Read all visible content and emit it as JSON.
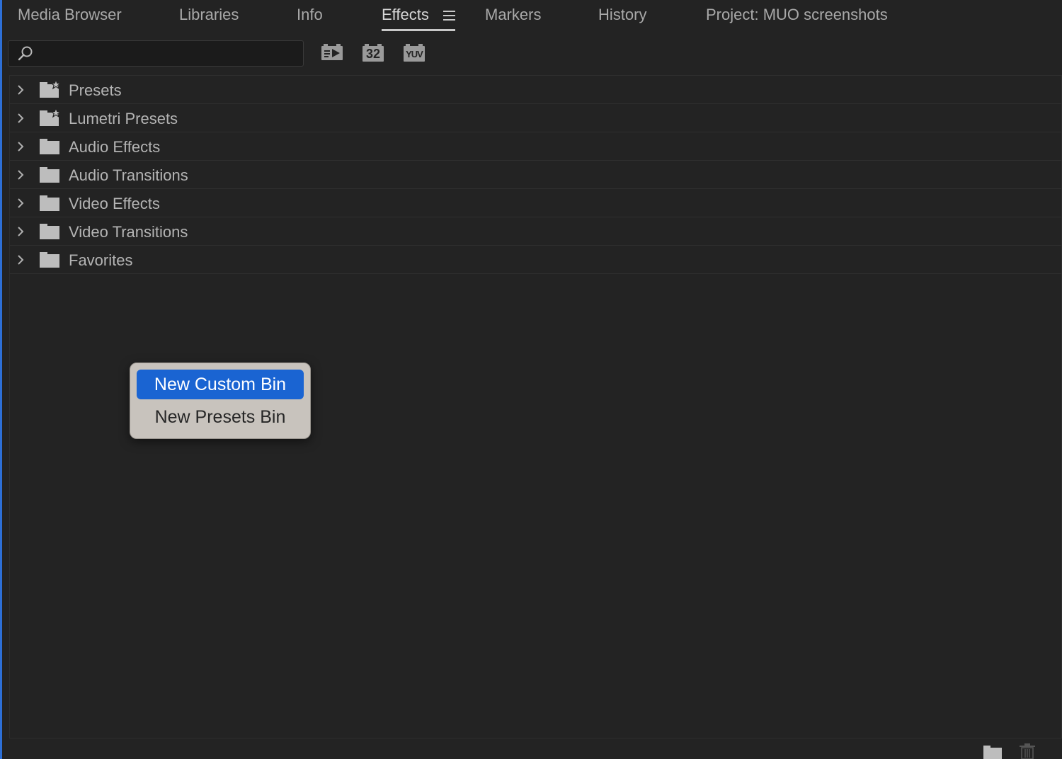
{
  "tabs": [
    {
      "label": "Media Browser",
      "active": false
    },
    {
      "label": "Libraries",
      "active": false
    },
    {
      "label": "Info",
      "active": false
    },
    {
      "label": "Effects",
      "active": true
    },
    {
      "label": "Markers",
      "active": false
    },
    {
      "label": "History",
      "active": false
    },
    {
      "label": "Project: MUO screenshots",
      "active": false
    }
  ],
  "tab_menu_icon": "hamburger-menu-icon",
  "search": {
    "placeholder": "",
    "value": "",
    "icon": "search-icon"
  },
  "toolbar": {
    "accelerated_effects_icon": "accelerated-effects-icon",
    "bit_depth_label": "32",
    "yuv_label": "YUV"
  },
  "tree": {
    "items": [
      {
        "label": "Presets",
        "icon": "preset-folder-icon"
      },
      {
        "label": "Lumetri Presets",
        "icon": "preset-folder-icon"
      },
      {
        "label": "Audio Effects",
        "icon": "folder-icon"
      },
      {
        "label": "Audio Transitions",
        "icon": "folder-icon"
      },
      {
        "label": "Video Effects",
        "icon": "folder-icon"
      },
      {
        "label": "Video Transitions",
        "icon": "folder-icon"
      },
      {
        "label": "Favorites",
        "icon": "folder-icon"
      }
    ]
  },
  "context_menu": {
    "items": [
      {
        "label": "New Custom Bin",
        "highlighted": true
      },
      {
        "label": "New Presets Bin",
        "highlighted": false
      }
    ]
  },
  "bottom_bar": {
    "new_bin_icon": "new-bin-icon",
    "delete_icon": "trash-icon"
  },
  "colors": {
    "background": "#232323",
    "accent": "#1a64d2",
    "menu_background": "#c8c3bd",
    "left_border": "#2d6fd6"
  }
}
